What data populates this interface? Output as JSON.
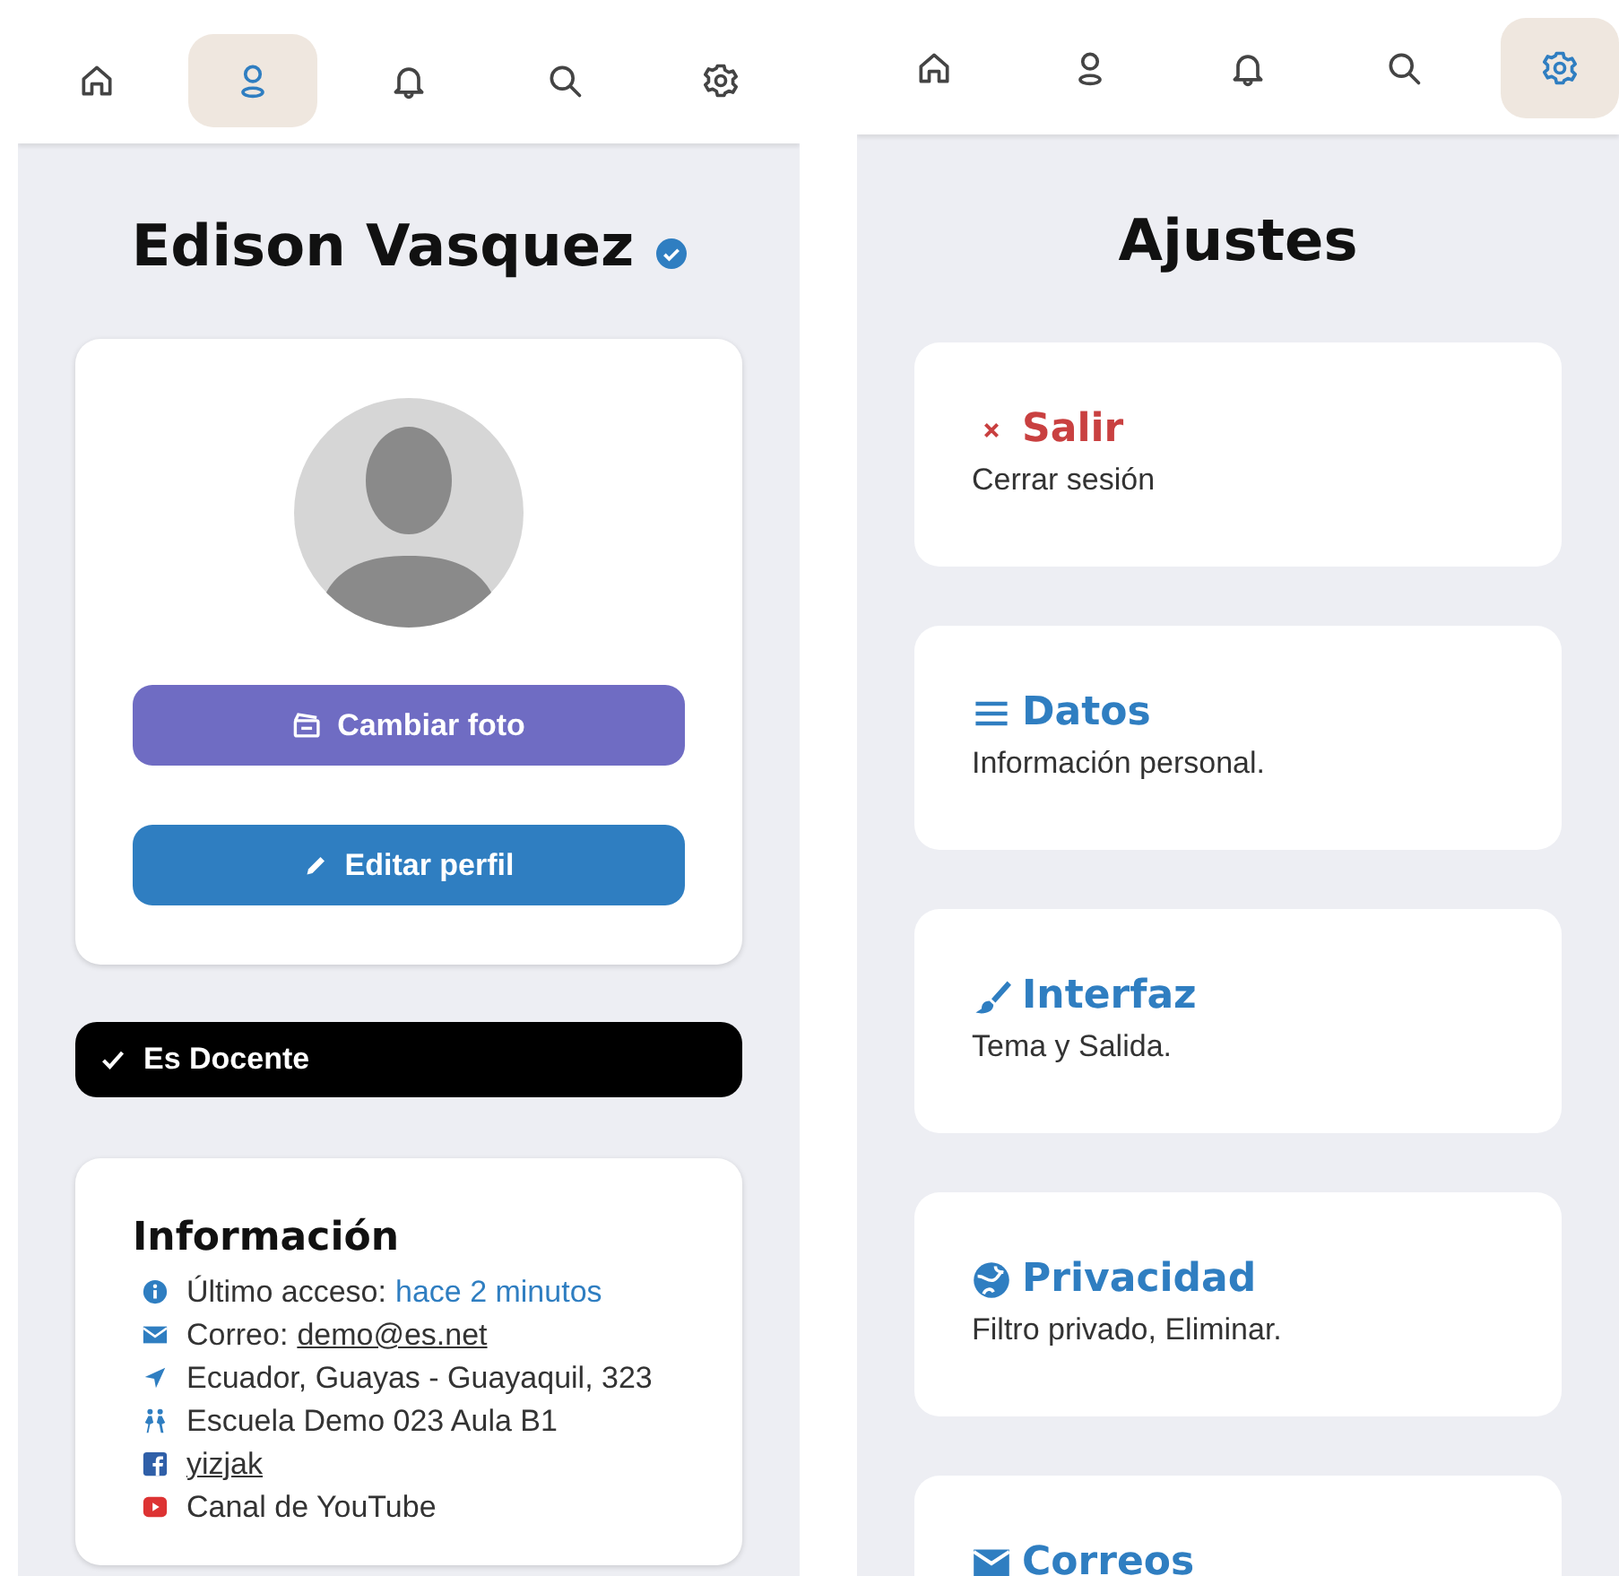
{
  "profile_screen": {
    "nav": [
      {
        "kind": "home",
        "selected": false
      },
      {
        "kind": "user",
        "selected": true
      },
      {
        "kind": "bell",
        "selected": false
      },
      {
        "kind": "search",
        "selected": false
      },
      {
        "kind": "gear",
        "selected": false
      }
    ],
    "name": "Edison Vasquez",
    "verified": true,
    "buttons": [
      {
        "kind": "photo",
        "label": "Cambiar foto"
      },
      {
        "kind": "edit",
        "label": "Editar perfil"
      }
    ],
    "role_badge": {
      "label": "Es Docente",
      "checked": true
    },
    "info": {
      "title": "Información",
      "items": [
        {
          "kind": "info",
          "text": "Último acceso:",
          "link": "hace 2 minutos"
        },
        {
          "kind": "mail",
          "text": "Correo:",
          "link": "demo@es.net"
        },
        {
          "kind": "location",
          "text": "Ecuador, Guayas - Guayaquil, 323"
        },
        {
          "kind": "people",
          "text": "Escuela Demo 023 Aula B1"
        },
        {
          "kind": "facebook",
          "link": "yizjak"
        },
        {
          "kind": "youtube",
          "text": "Canal de YouTube"
        }
      ]
    }
  },
  "settings_screen": {
    "nav": [
      {
        "kind": "home",
        "selected": false
      },
      {
        "kind": "user",
        "selected": false
      },
      {
        "kind": "bell",
        "selected": false
      },
      {
        "kind": "search",
        "selected": false
      },
      {
        "kind": "gear",
        "selected": true
      }
    ],
    "title": "Ajustes",
    "cards": [
      {
        "kind": "logout",
        "title": "Salir",
        "subtitle": "Cerrar sesión"
      },
      {
        "kind": "data",
        "title": "Datos",
        "subtitle": "Información personal."
      },
      {
        "kind": "interface",
        "title": "Interfaz",
        "subtitle": "Tema y Salida."
      },
      {
        "kind": "privacy",
        "title": "Privacidad",
        "subtitle": "Filtro privado, Eliminar."
      },
      {
        "kind": "mail",
        "title": "Correos"
      }
    ]
  }
}
